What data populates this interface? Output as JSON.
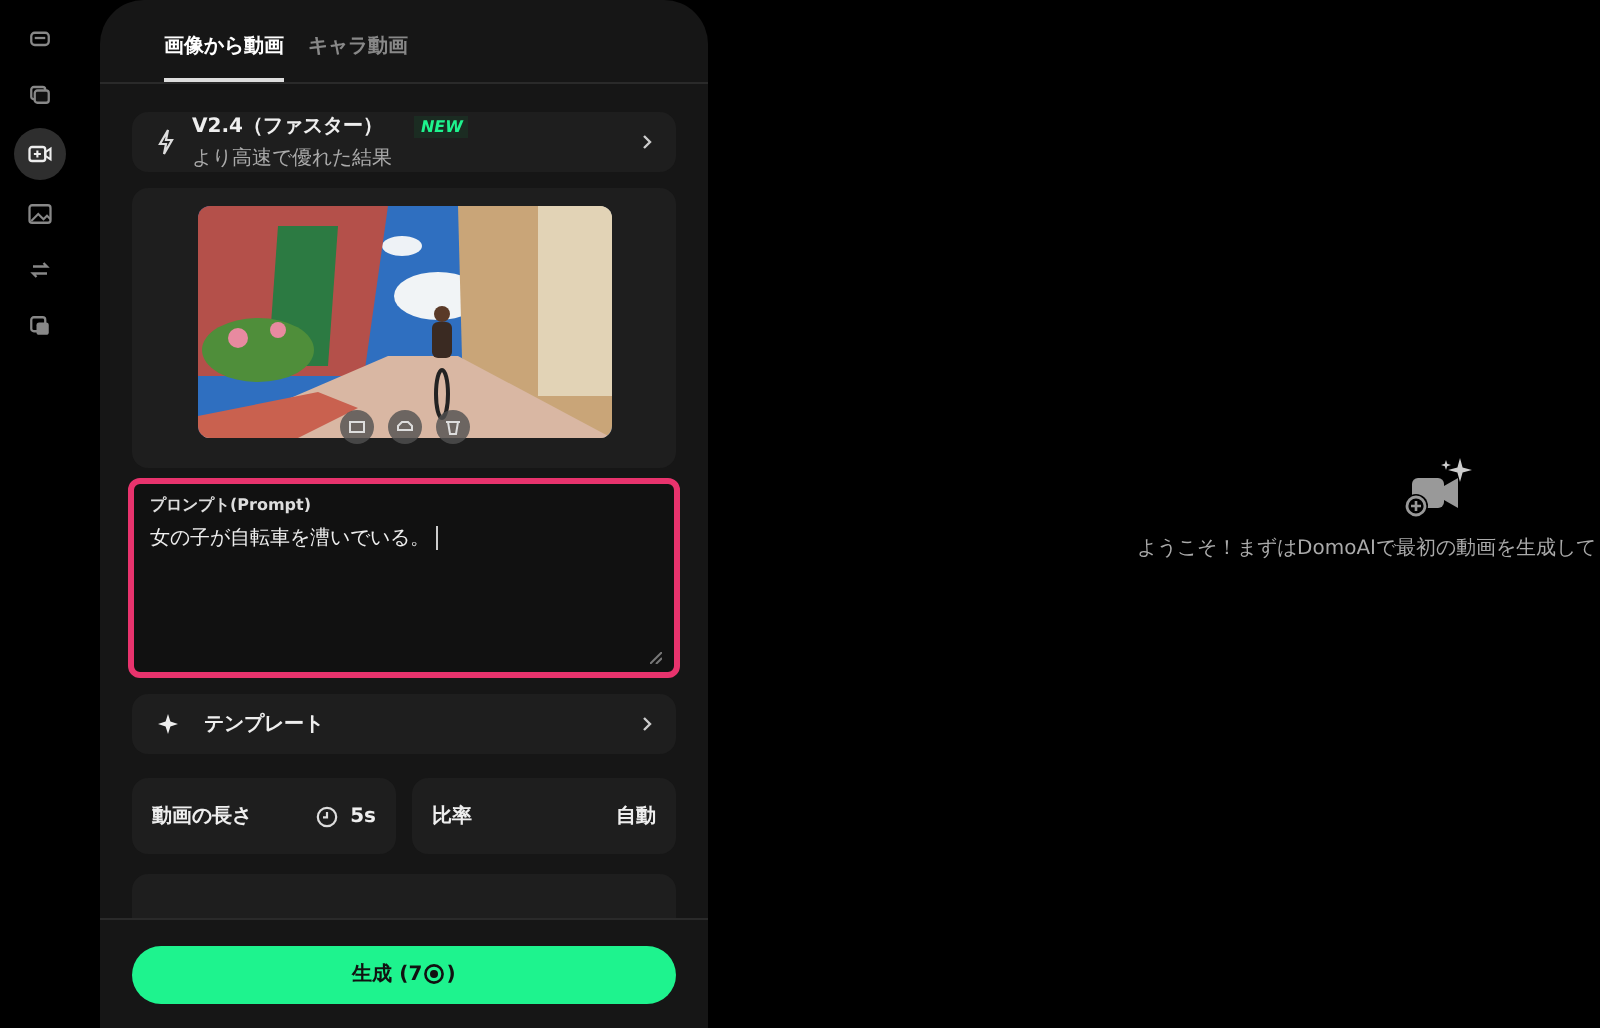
{
  "sidebar": {
    "items": [
      {
        "selected": false
      },
      {
        "selected": false
      },
      {
        "selected": true
      },
      {
        "selected": false
      },
      {
        "selected": false
      },
      {
        "selected": false
      }
    ]
  },
  "tabs": [
    {
      "label": "画像から動画",
      "selected": true
    },
    {
      "label": "キャラ動画",
      "selected": false
    }
  ],
  "model": {
    "name": "V2.4（ファスター）",
    "badge": "NEW",
    "description": "より高速で優れた結果"
  },
  "prompt": {
    "label": "プロンプト(Prompt)",
    "value": "女の子が自転車を漕いでいる。"
  },
  "template": {
    "label": "テンプレート"
  },
  "settings": [
    {
      "kind": "duration",
      "label": "動画の長さ",
      "value": "5s"
    },
    {
      "kind": "plain",
      "label": "比率",
      "value": "自動"
    }
  ],
  "generate_button": {
    "label": "生成 (7",
    "suffix": ")"
  },
  "welcome": {
    "message": "ようこそ！まずはDomoAIで最初の動画を生成して"
  }
}
